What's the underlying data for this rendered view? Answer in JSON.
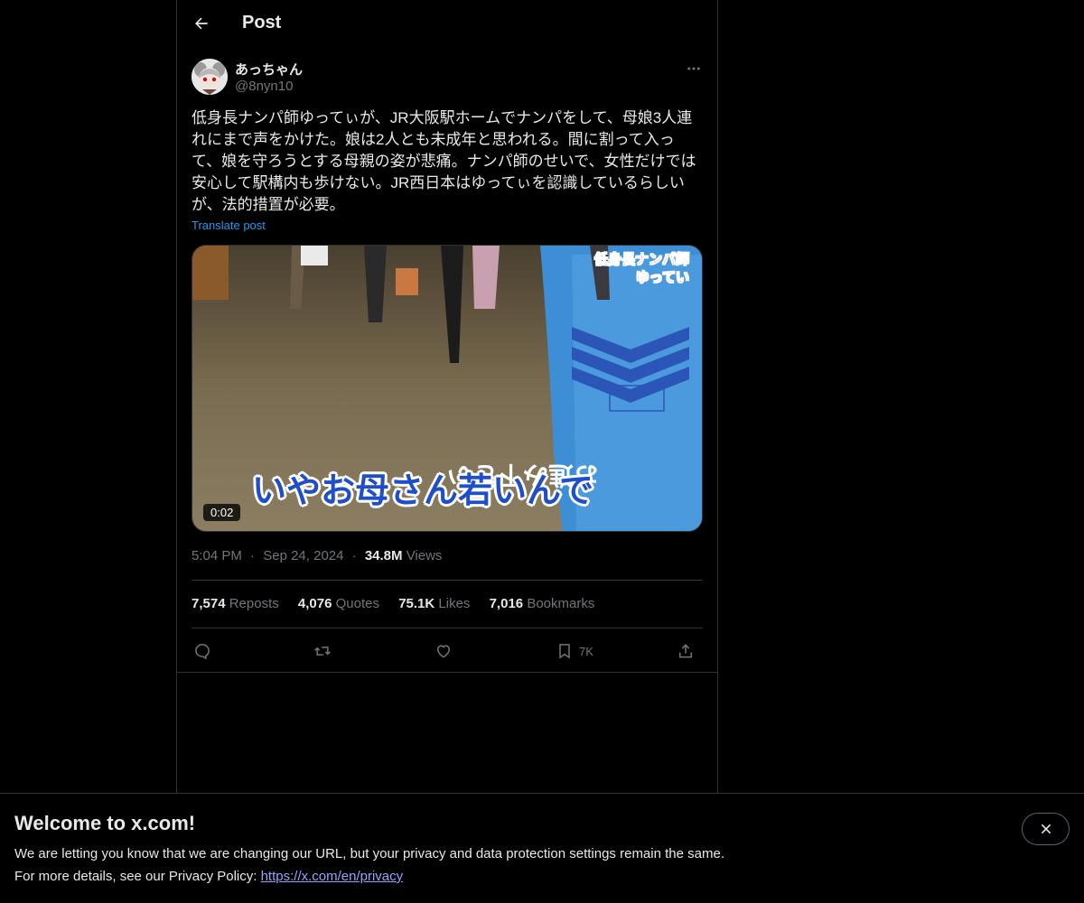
{
  "header": {
    "title": "Post"
  },
  "author": {
    "name": "あっちゃん",
    "handle": "@8nyn10"
  },
  "post": {
    "text": "低身長ナンパ師ゆってぃが、JR大阪駅ホームでナンパをして、母娘3人連れにまで声をかけた。娘は2人とも未成年と思われる。間に割って入って、娘を守ろうとする母親の姿が悲痛。ナンパ師のせいで、女性だけでは安心して駅構内も歩けない。JR西日本はゆってぃを認識しているらしいが、法的措置が必要。",
    "translate_label": "Translate post"
  },
  "media": {
    "duration": "0:02",
    "overlay_line1": "低身長ナンパ師",
    "overlay_line2": "ゆってい",
    "caption": "いやお母さん若いんで",
    "floor_text": "お進み下さい"
  },
  "meta": {
    "time": "5:04 PM",
    "date": "Sep 24, 2024",
    "views": "34.8M",
    "views_label": "Views",
    "sep": "·"
  },
  "stats": {
    "reposts": "7,574",
    "reposts_label": "Reposts",
    "quotes": "4,076",
    "quotes_label": "Quotes",
    "likes": "75.1K",
    "likes_label": "Likes",
    "bookmarks": "7,016",
    "bookmarks_label": "Bookmarks"
  },
  "actions": {
    "bookmark_count": "7K"
  },
  "banner": {
    "title": "Welcome to x.com!",
    "line1": "We are letting you know that we are changing our URL, but your privacy and data protection settings remain the same.",
    "line2_prefix": "For more details, see our Privacy Policy: ",
    "link": "https://x.com/en/privacy"
  },
  "icons": {
    "back": "arrow-left-icon",
    "more": "more-horizontal-icon",
    "reply": "reply-icon",
    "repost": "repost-icon",
    "like": "heart-icon",
    "bookmark": "bookmark-icon",
    "share": "share-icon",
    "close": "close-icon"
  },
  "colors": {
    "background": "#000000",
    "text": "#e7e9ea",
    "muted": "#71767b",
    "accent": "#1d9bf0",
    "border": "#2f3336"
  }
}
